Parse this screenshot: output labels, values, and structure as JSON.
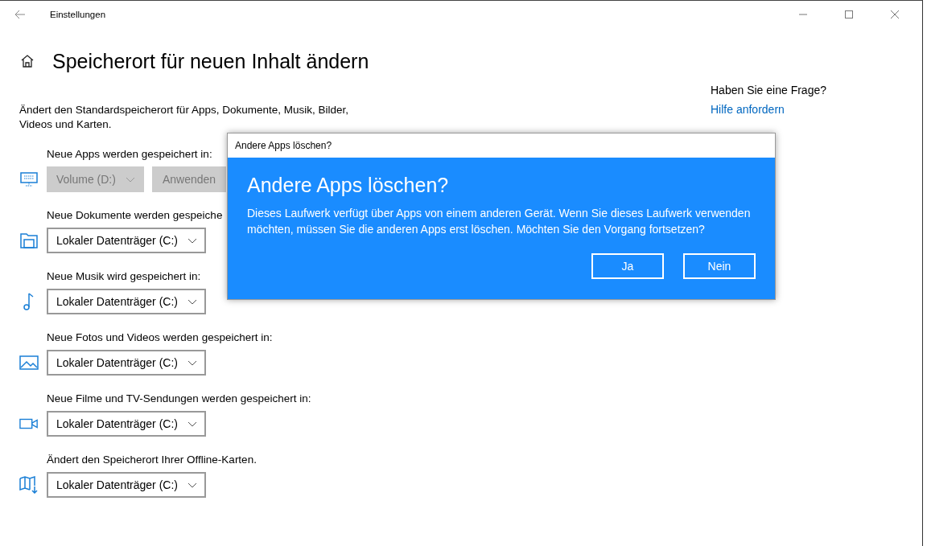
{
  "window": {
    "title": "Einstellungen"
  },
  "page": {
    "title": "Speicherort für neuen Inhalt ändern",
    "description": "Ändert den Standardspeicherort für Apps, Dokumente, Musik, Bilder, Videos und Karten."
  },
  "sections": [
    {
      "label": "Neue Apps werden gespeichert in:",
      "dropdown": {
        "value": "Volume (D:)",
        "disabled": true
      },
      "apply_button": {
        "label": "Anwenden",
        "disabled": true
      }
    },
    {
      "label": "Neue Dokumente werden gespeiche",
      "dropdown": {
        "value": "Lokaler Datenträger (C:)",
        "disabled": false
      }
    },
    {
      "label": "Neue Musik wird gespeichert in:",
      "dropdown": {
        "value": "Lokaler Datenträger (C:)",
        "disabled": false
      }
    },
    {
      "label": "Neue Fotos und Videos werden gespeichert in:",
      "dropdown": {
        "value": "Lokaler Datenträger (C:)",
        "disabled": false
      }
    },
    {
      "label": "Neue Filme und TV-Sendungen werden gespeichert in:",
      "dropdown": {
        "value": "Lokaler Datenträger (C:)",
        "disabled": false
      }
    },
    {
      "label": "Ändert den Speicherort Ihrer Offline-Karten.",
      "dropdown": {
        "value": "Lokaler Datenträger (C:)",
        "disabled": false
      }
    }
  ],
  "help": {
    "heading": "Haben Sie eine Frage?",
    "link": "Hilfe anfordern"
  },
  "dialog": {
    "window_title": "Andere Apps löschen?",
    "heading": "Andere Apps löschen?",
    "message": "Dieses Laufwerk verfügt über Apps von einem anderen Gerät. Wenn Sie dieses Laufwerk verwenden möchten, müssen Sie die anderen Apps erst löschen. Möchten Sie den Vorgang fortsetzen?",
    "buttons": [
      "Ja",
      "Nein"
    ]
  }
}
